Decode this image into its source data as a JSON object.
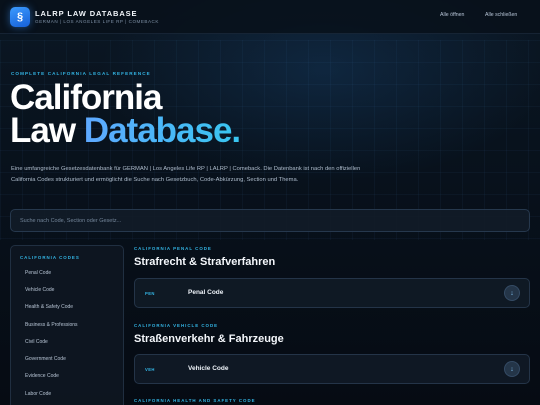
{
  "header": {
    "logo_glyph": "§",
    "title": "LALRP LAW DATABASE",
    "subtitle": "GERMAN | LOS ANGELES LIFE RP | COMEBACK",
    "open_all": "Alle öffnen",
    "close_all": "Alle schließen"
  },
  "hero": {
    "eyebrow": "COMPLETE CALIFORNIA LEGAL REFERENCE",
    "title_line1": "California",
    "title_line2_plain": "Law ",
    "title_line2_accent": "Database.",
    "description": "Eine umfangreiche Gesetzesdatenbank für GERMAN | Los Angeles Life RP | LALRP | Comeback. Die Datenbank ist nach den offiziellen California Codes strukturiert und ermöglicht die Suche nach Gesetzbuch, Code-Abkürzung, Section und Thema."
  },
  "search": {
    "placeholder": "Suche nach Code, Section oder Gesetz...",
    "value": ""
  },
  "sidebar": {
    "heading": "CALIFORNIA CODES",
    "items": [
      {
        "label": "Penal Code"
      },
      {
        "label": "Vehicle Code"
      },
      {
        "label": "Health & Safety Code"
      },
      {
        "label": "Business & Professions"
      },
      {
        "label": "Civil Code"
      },
      {
        "label": "Government Code"
      },
      {
        "label": "Evidence Code"
      },
      {
        "label": "Labor Code"
      }
    ]
  },
  "sections": [
    {
      "eyebrow": "CALIFORNIA PENAL CODE",
      "title": "Strafrecht & Strafverfahren",
      "card": {
        "abbr": "PEN",
        "name": "Penal Code",
        "toggle_icon": "↓"
      }
    },
    {
      "eyebrow": "CALIFORNIA VEHICLE CODE",
      "title": "Straßenverkehr & Fahrzeuge",
      "card": {
        "abbr": "VEH",
        "name": "Vehicle Code",
        "toggle_icon": "↓"
      }
    },
    {
      "eyebrow": "CALIFORNIA HEALTH AND SAFETY CODE"
    }
  ],
  "colors": {
    "accent": "#33b6e6",
    "brand_blue": "#2d84f0",
    "background": "#070d16"
  }
}
